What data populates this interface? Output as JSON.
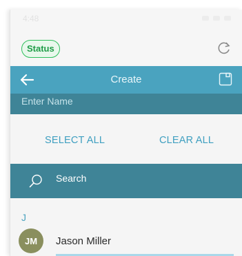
{
  "status_bar": {
    "time": "4:48"
  },
  "top": {
    "status_label": "Status",
    "refresh_icon": "refresh-icon"
  },
  "header": {
    "title": "Create",
    "back_icon": "back-arrow-icon",
    "save_icon": "save-icon"
  },
  "name_field": {
    "placeholder": "Enter Name",
    "value": ""
  },
  "actions": {
    "select_all": "SELECT ALL",
    "clear_all": "CLEAR ALL"
  },
  "search": {
    "placeholder": "Search",
    "value": ""
  },
  "contacts": {
    "section_letter": "J",
    "items": [
      {
        "initials": "JM",
        "name": "Jason Miller"
      }
    ]
  },
  "colors": {
    "header": "#4aa3bf",
    "dark_bar": "#3f8497",
    "accent": "#3f9fc0",
    "status_green": "#2dbf5b",
    "avatar": "#8a8f5e"
  }
}
